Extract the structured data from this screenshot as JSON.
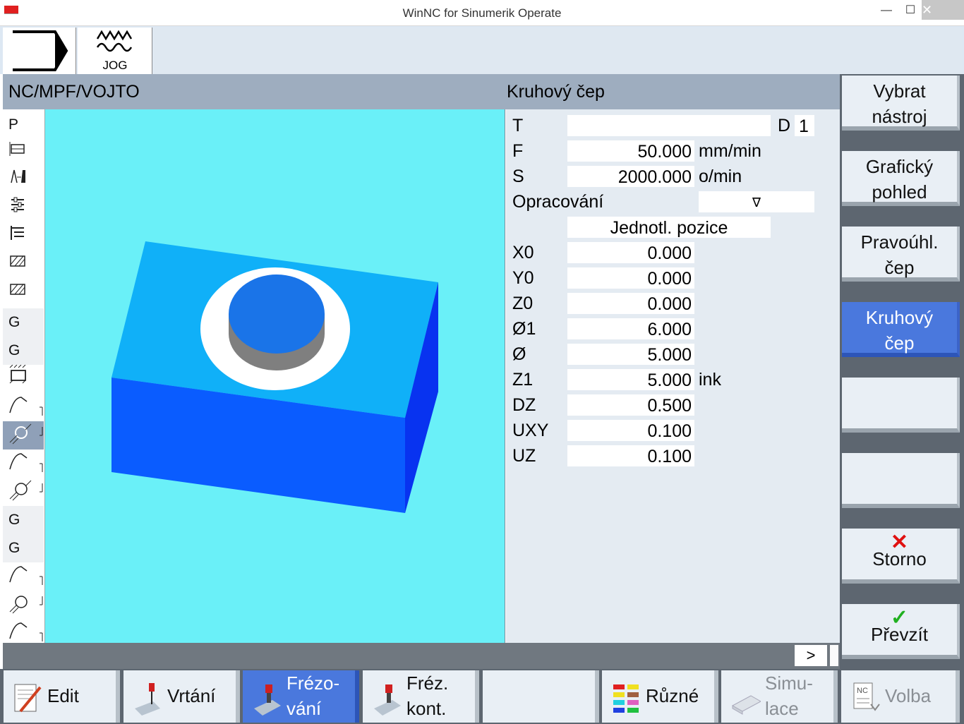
{
  "window": {
    "title": "WinNC for Sinumerik Operate",
    "minimize": "—",
    "maximize": "☐",
    "close": "✕"
  },
  "header": {
    "mode_label": "JOG"
  },
  "pathbar": {
    "program_path": "NC/MPF/VOJTO",
    "cycle_name": "Kruhový čep"
  },
  "strip": {
    "items": [
      "P",
      "",
      "",
      "",
      "",
      "",
      "",
      "G",
      "G",
      "",
      "",
      "",
      "",
      "",
      "G",
      "G",
      "",
      "",
      ""
    ]
  },
  "params": {
    "T": {
      "label": "T",
      "value": ""
    },
    "D": {
      "label": "D",
      "value": "1"
    },
    "F": {
      "label": "F",
      "value": "50.000",
      "unit": "mm/min"
    },
    "S": {
      "label": "S",
      "value": "2000.000",
      "unit": "o/min"
    },
    "machining": {
      "label": "Opracování",
      "value": "∇"
    },
    "position_mode": "Jednotl. pozice",
    "rows": [
      {
        "label": "X0",
        "value": "0.000",
        "unit": ""
      },
      {
        "label": "Y0",
        "value": "0.000",
        "unit": ""
      },
      {
        "label": "Z0",
        "value": "0.000",
        "unit": ""
      },
      {
        "label": "Ø1",
        "value": "6.000",
        "unit": ""
      },
      {
        "label": "Ø",
        "value": "5.000",
        "unit": ""
      },
      {
        "label": "Z1",
        "value": "5.000",
        "unit": "ink"
      },
      {
        "label": "DZ",
        "value": "0.500",
        "unit": ""
      },
      {
        "label": "UXY",
        "value": "0.100",
        "unit": ""
      },
      {
        "label": "UZ",
        "value": "0.100",
        "unit": ""
      }
    ]
  },
  "statusbar": {
    "more": ">"
  },
  "right_softkeys": [
    {
      "line1": "Vybrat",
      "line2": "nástroj"
    },
    {
      "line1": "Grafický",
      "line2": "pohled"
    },
    {
      "line1": "Pravoúhl.",
      "line2": "čep"
    },
    {
      "line1": "Kruhový",
      "line2": "čep"
    },
    {
      "line1": "",
      "line2": ""
    },
    {
      "line1": "",
      "line2": ""
    },
    {
      "line1": "Storno",
      "line2": ""
    },
    {
      "line1": "Převzít",
      "line2": ""
    }
  ],
  "bottom_softkeys": [
    {
      "line1": "Edit",
      "line2": ""
    },
    {
      "line1": "Vrtání",
      "line2": ""
    },
    {
      "line1": "Frézo-",
      "line2": "vání"
    },
    {
      "line1": "Fréz.",
      "line2": "kont."
    },
    {
      "line1": "",
      "line2": ""
    },
    {
      "line1": "Různé",
      "line2": ""
    },
    {
      "line1": "Simu-",
      "line2": "lace"
    },
    {
      "line1": "Volba",
      "line2": ""
    }
  ],
  "colors": {
    "active_softkey": "#4a78dd",
    "graphic_bg": "#6af0f8",
    "block_top": "#10b0f8",
    "block_front": "#0a5cff",
    "block_side": "#0833f0"
  }
}
